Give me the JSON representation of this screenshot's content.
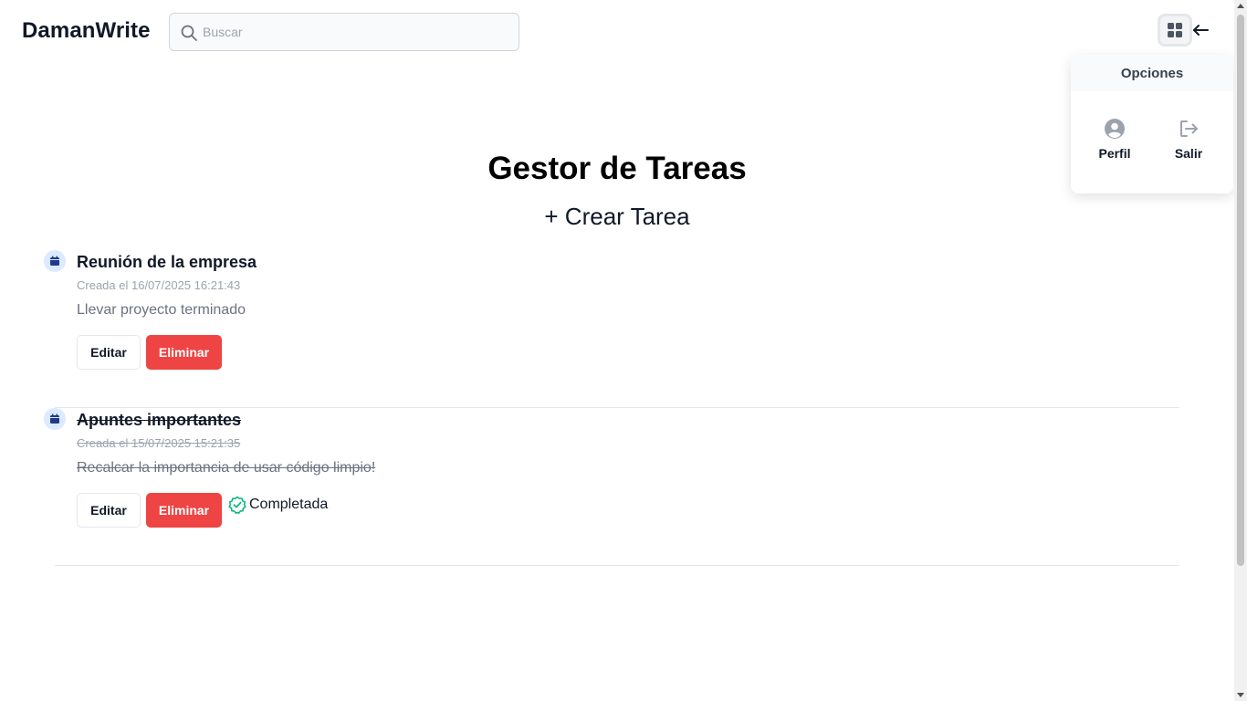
{
  "header": {
    "brand": "DamanWrite",
    "search_placeholder": "Buscar"
  },
  "menu": {
    "title": "Opciones",
    "items": [
      {
        "label": "Perfil",
        "icon": "user-circle-icon"
      },
      {
        "label": "Salir",
        "icon": "logout-icon"
      }
    ]
  },
  "main": {
    "title": "Gestor de Tareas",
    "create_label": "+ Crear Tarea"
  },
  "tasks": [
    {
      "title": "Reunión de la empresa",
      "date": "Creada el 16/07/2025 16:21:43",
      "description": "Llevar proyecto terminado",
      "edit_label": "Editar",
      "delete_label": "Eliminar",
      "completed": false
    },
    {
      "title": "Apuntes importantes",
      "date": "Creada el 15/07/2025 15:21:35",
      "description": "Recalcar la importancia de usar código limpio!",
      "edit_label": "Editar",
      "delete_label": "Eliminar",
      "completed": true,
      "status_label": "Completada"
    }
  ],
  "colors": {
    "danger": "#ef4444",
    "success": "#10b981",
    "calendar_icon": "#1e3a8a",
    "calendar_bg": "#dbeafe"
  }
}
